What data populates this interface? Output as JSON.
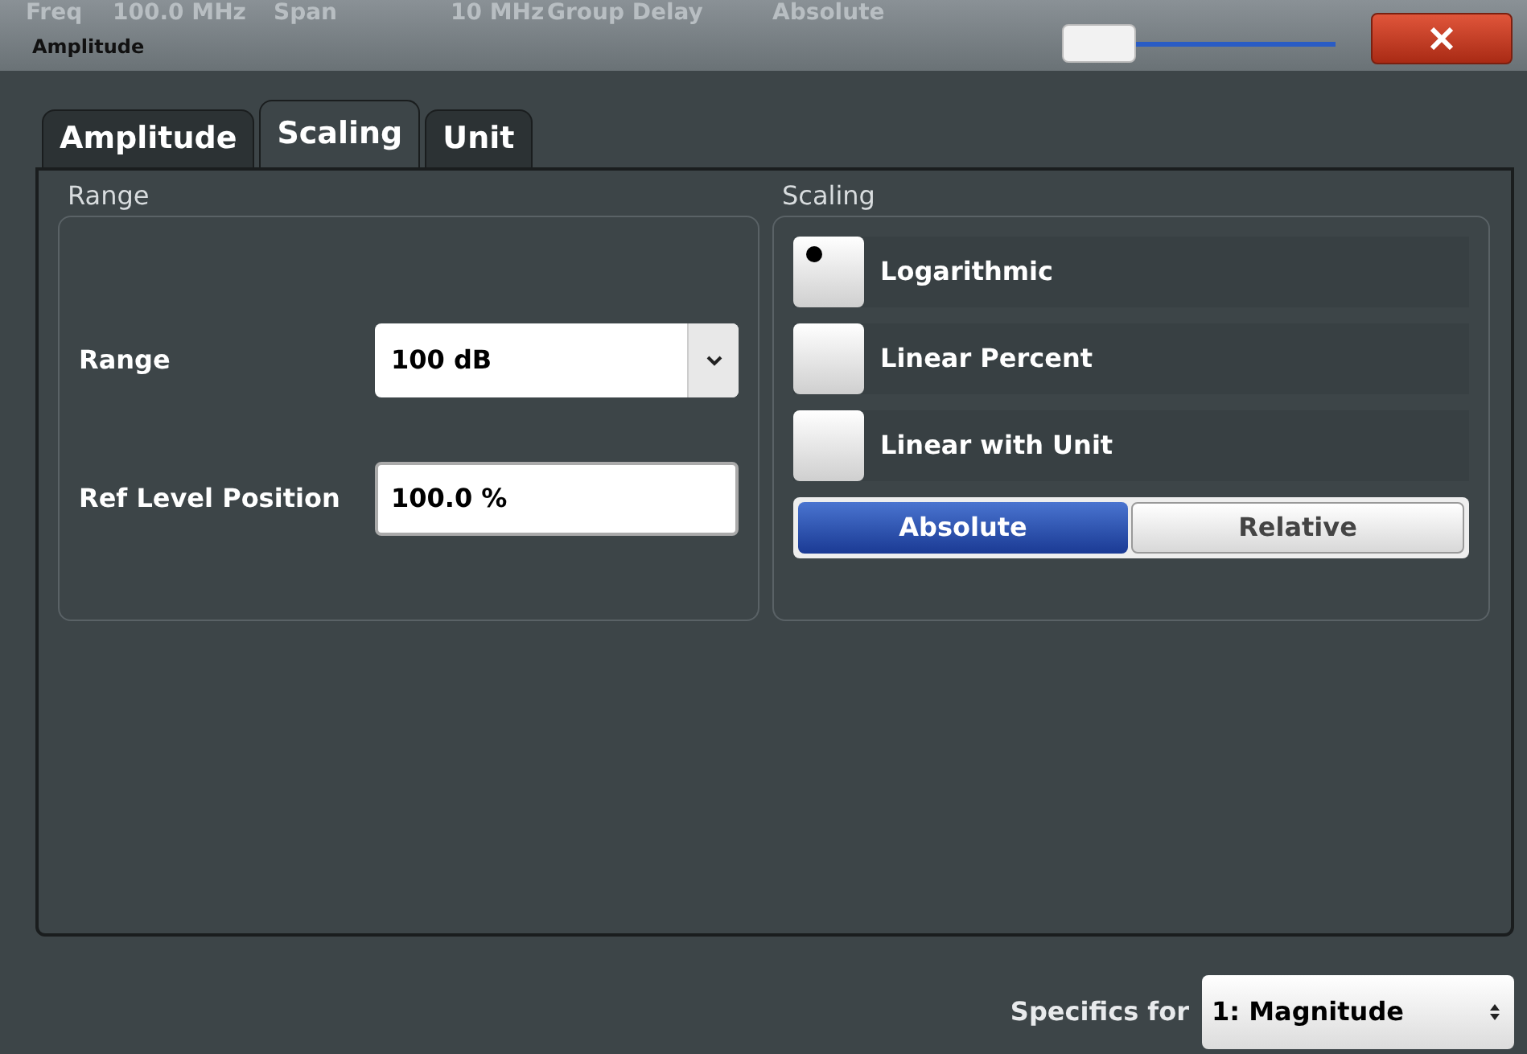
{
  "background_bar": [
    "Freq",
    "100.0 MHz",
    "Span",
    "10 MHz",
    "Group Delay",
    "Absolute"
  ],
  "window": {
    "title": "Amplitude"
  },
  "slider": {
    "level": 0.0
  },
  "tabs": [
    {
      "label": "Amplitude",
      "selected": false
    },
    {
      "label": "Scaling",
      "selected": true
    },
    {
      "label": "Unit",
      "selected": false
    }
  ],
  "range_group": {
    "title": "Range",
    "range": {
      "label": "Range",
      "value": "100 dB"
    },
    "ref_level_position": {
      "label": "Ref Level Position",
      "value": "100.0 %"
    }
  },
  "scaling_group": {
    "title": "Scaling",
    "options": [
      {
        "label": "Logarithmic",
        "selected": true
      },
      {
        "label": "Linear Percent",
        "selected": false
      },
      {
        "label": "Linear with Unit",
        "selected": false
      }
    ],
    "mode": [
      {
        "label": "Absolute",
        "selected": true
      },
      {
        "label": "Relative",
        "selected": false
      }
    ]
  },
  "specifics": {
    "label": "Specifics for",
    "value": "1: Magnitude"
  }
}
